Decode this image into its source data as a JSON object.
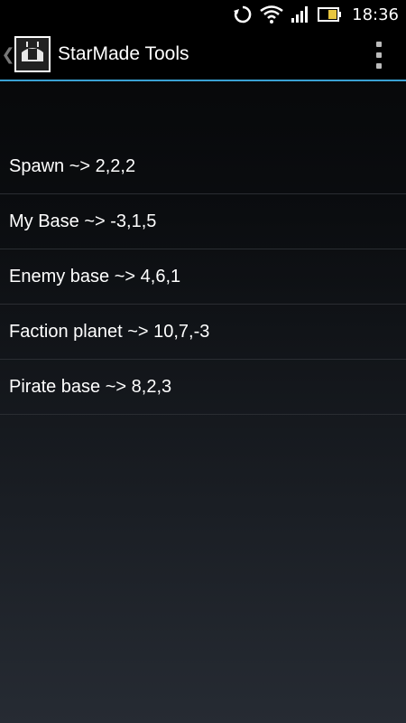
{
  "status_bar": {
    "time": "18:36",
    "icons": [
      "sync-icon",
      "wifi-icon",
      "signal-icon",
      "battery-icon"
    ]
  },
  "action_bar": {
    "title": "StarMade Tools",
    "icon_text": "StarMade Tools",
    "accent_color": "#3aa2d3"
  },
  "list": {
    "items": [
      {
        "label": "Spawn ~> 2,2,2"
      },
      {
        "label": "My Base ~> -3,1,5"
      },
      {
        "label": "Enemy base ~> 4,6,1"
      },
      {
        "label": "Faction planet ~> 10,7,-3"
      },
      {
        "label": "Pirate base ~> 8,2,3"
      }
    ]
  }
}
